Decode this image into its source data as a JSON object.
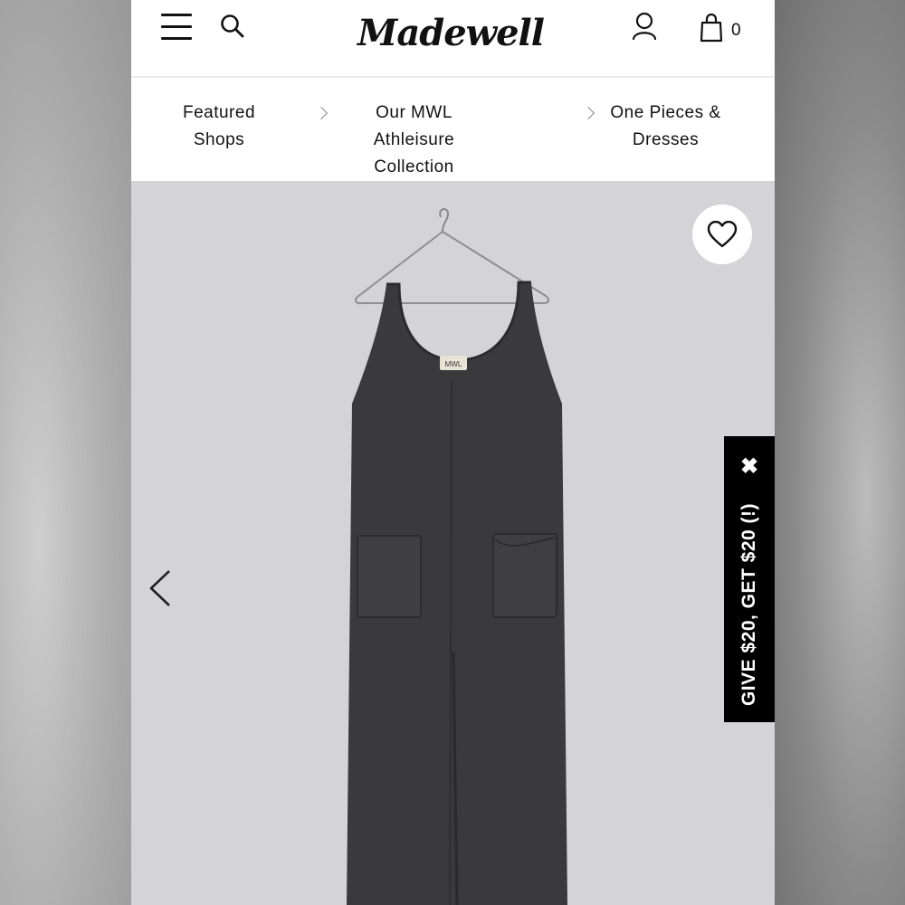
{
  "header": {
    "logo_text": "Madewell",
    "bag_count": "0",
    "icons": [
      "menu-icon",
      "search-icon",
      "account-icon",
      "bag-icon"
    ]
  },
  "breadcrumbs": [
    {
      "line1": "Featured",
      "line2": "Shops"
    },
    {
      "line1": "Our MWL Athleisure",
      "line2": "Collection"
    },
    {
      "line1": "One Pieces &",
      "line2": "Dresses"
    }
  ],
  "product": {
    "label_text": "MWL",
    "colors": {
      "garment": "#3a3a3c",
      "background": "#d4d4d6"
    }
  },
  "promo": {
    "text": "GIVE $20, GET $20 (!)",
    "close_glyph": "✖",
    "background": "#000000"
  }
}
